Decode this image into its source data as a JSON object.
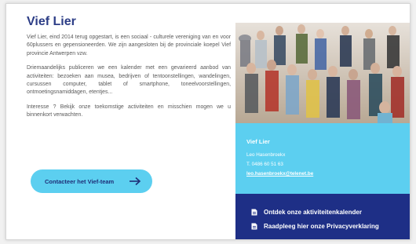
{
  "title": "Vief Lier",
  "paragraphs": [
    "Vief Lier, eind 2014 terug opgestart, is een sociaal - culturele vereniging van en voor 60plussers en gepensioneerden. We zijn aangesloten bij de provinciale koepel Vief provincie Antwerpen vzw.",
    "Driemaandelijks publiceren we een kalender met een gevarieerd aanbod van activiteiten: bezoeken aan musea, bedrijven of tentoonstellingen, wandelingen, cursussen computer, tablet of smartphone, toneelvoorstellingen, ontmoetingsnamiddagen, etentjes...",
    "Interesse ? Bekijk onze toekomstige activiteiten en misschien mogen we u binnenkort verwachten."
  ],
  "cta": {
    "label": "Contacteer het Vief-team",
    "icon": "arrow-right-icon"
  },
  "contact": {
    "name": "Vief Lier",
    "person": "Leo Hasenbroekx",
    "phone": "T. 0486 60 51 63",
    "email": "leo.hasenbroekx@telenet.be"
  },
  "links": [
    {
      "label": "Ontdek onze aktiviteitenkalender",
      "icon": "document-icon"
    },
    {
      "label": "Raadpleeg hier onze Privacyverklaring",
      "icon": "document-icon"
    }
  ],
  "colors": {
    "title": "#2c3d86",
    "accent_light_blue": "#5ccff0",
    "accent_dark_blue": "#1e2f86",
    "text_gray": "#5a5a5a"
  }
}
